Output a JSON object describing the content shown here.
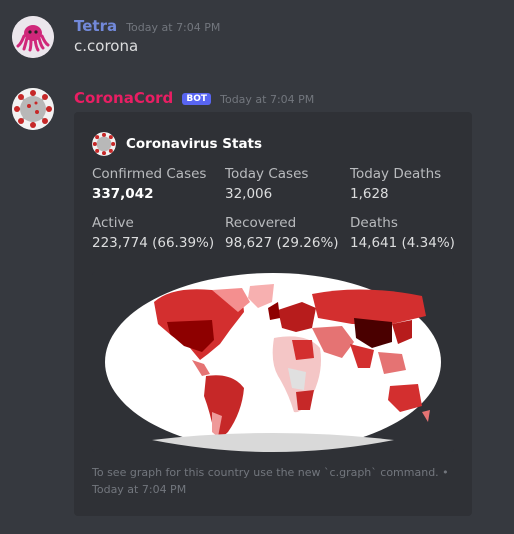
{
  "messages": [
    {
      "username": "Tetra",
      "username_color": "#7289da",
      "timestamp": "Today at 7:04 PM",
      "content": "c.corona",
      "avatar_icon": "octopus-avatar-icon"
    },
    {
      "username": "CoronaCord",
      "username_color": "#e91e63",
      "bot_tag": "BOT",
      "timestamp": "Today at 7:04 PM",
      "avatar_icon": "virus-avatar-icon",
      "embed": {
        "author_name": "Coronavirus Stats",
        "author_icon": "virus-icon",
        "fields": [
          {
            "name": "Confirmed Cases",
            "value": "337,042"
          },
          {
            "name": "Today Cases",
            "value": "32,006"
          },
          {
            "name": "Today Deaths",
            "value": "1,628"
          },
          {
            "name": "Active",
            "value": "223,774 (66.39%)"
          },
          {
            "name": "Recovered",
            "value": "98,627 (29.26%)"
          },
          {
            "name": "Deaths",
            "value": "14,641 (4.34%)"
          }
        ],
        "image": "world-choropleth-map",
        "footer_text": "To see graph for this country use the new `c.graph` command. •",
        "footer_time": "Today at 7:04 PM",
        "accent_color": "#c62828"
      }
    }
  ]
}
